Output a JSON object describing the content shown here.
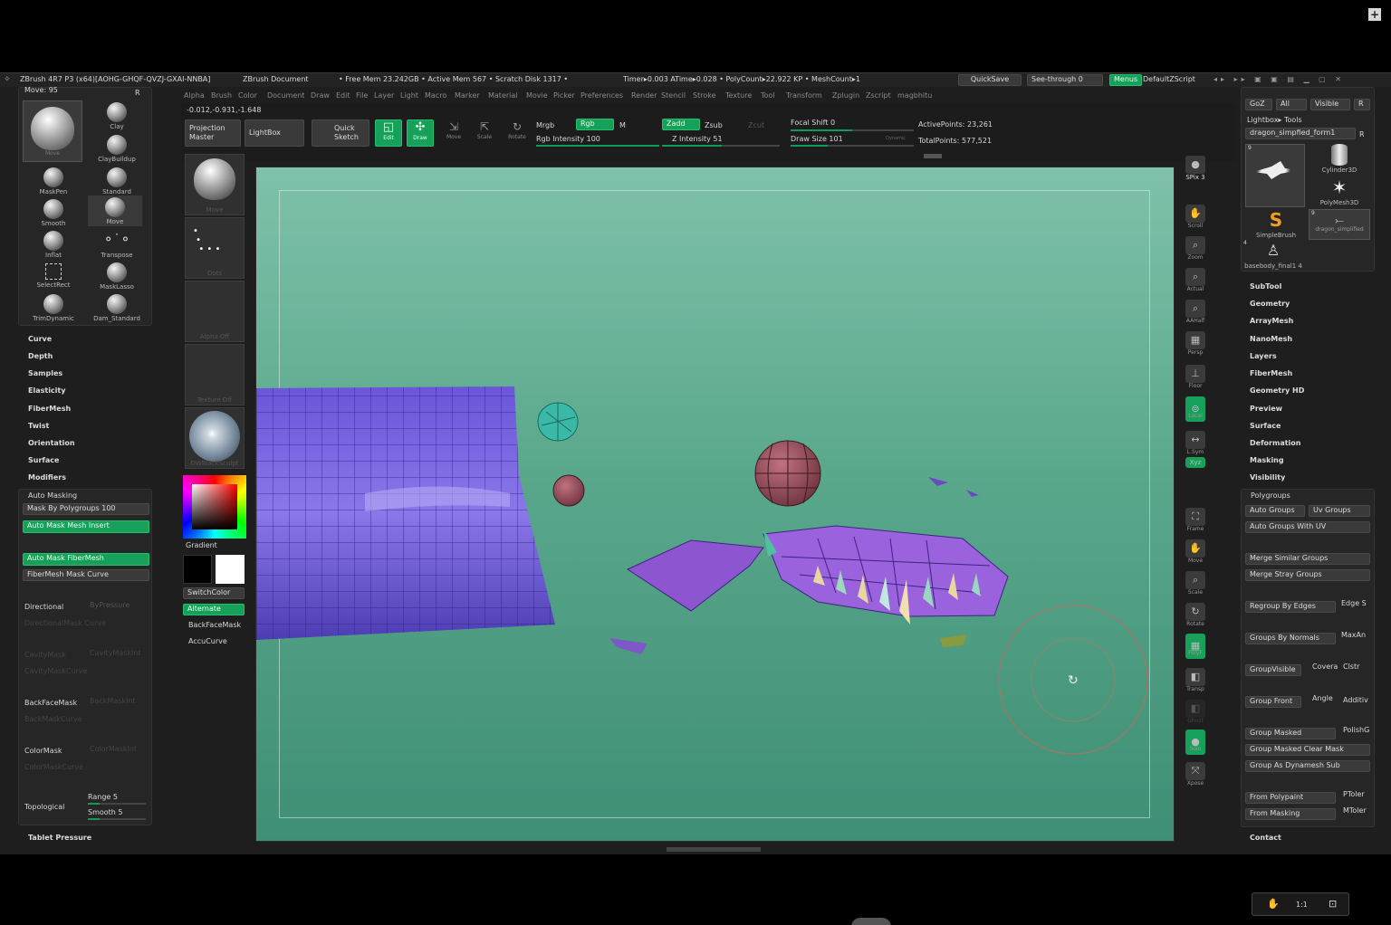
{
  "titlebar": {
    "app": "ZBrush 4R7 P3 (x64)[AOHG-GHQF-QVZJ-GXAI-NNBA]",
    "document": "ZBrush Document",
    "stats": "• Free Mem 23.242GB • Active Mem 567 • Scratch Disk 1317 •",
    "timer": "Timer▸0.003 ATime▸0.028 • PolyCount▸22.922 KP • MeshCount▸1",
    "quicksave": "QuickSave",
    "seethrough": "See-through 0",
    "menus": "Menus",
    "script": "DefaultZScript"
  },
  "menubar": [
    "Alpha",
    "Brush",
    "Color",
    "Document",
    "Draw",
    "Edit",
    "File",
    "Layer",
    "Light",
    "Macro",
    "Marker",
    "Material",
    "Movie",
    "Picker",
    "Preferences",
    "Render",
    "Stencil",
    "Stroke",
    "Texture",
    "Tool",
    "Transform",
    "Zplugin",
    "Zscript",
    "magbhitu"
  ],
  "coords": "-0.012,-0.931,-1.648",
  "toolbar": {
    "projection_master": "Projection Master",
    "lightbox": "LightBox",
    "quick_sketch": "Quick Sketch",
    "edit": "Edit",
    "draw": "Draw",
    "move": "Move",
    "scale": "Scale",
    "rotate": "Rotate",
    "mrgb": "Mrgb",
    "rgb": "Rgb",
    "m": "M",
    "rgb_intensity": "Rgb Intensity 100",
    "zadd": "Zadd",
    "zsub": "Zsub",
    "zcut": "Zcut",
    "z_intensity": "Z Intensity 51",
    "focal_shift": "Focal Shift 0",
    "draw_size": "Draw Size 101",
    "dynamic": "Dynamic",
    "active_points": "ActivePoints: 23,261",
    "total_points": "TotalPoints: 577,521"
  },
  "left_panel": {
    "header": "Move: 95",
    "r": "R",
    "main_brush": "Move",
    "brushes": [
      "Clay",
      "ClayBuildup",
      "MaskPen",
      "Standard",
      "Smooth",
      "Move",
      "Inflat",
      "Transpose",
      "SelectRect",
      "MaskLasso",
      "TrimDynamic",
      "Dam_Standard"
    ],
    "menu": [
      "Curve",
      "Depth",
      "Samples",
      "Elasticity",
      "FiberMesh",
      "Twist",
      "Orientation",
      "Surface",
      "Modifiers"
    ],
    "auto_masking": {
      "title": "Auto Masking",
      "mask_by_polygroups": "Mask By Polygroups 100",
      "auto_mask_mesh_insert": "Auto Mask Mesh Insert",
      "auto_mask_fibermesh": "Auto Mask FiberMesh",
      "fibermesh_mask_curve": "FiberMesh Mask Curve",
      "directional": "Directional",
      "by_pressure": "ByPressure",
      "directional_mask_curve": "DirectionalMask Curve",
      "cavity_mask": "CavityMask",
      "cavity_mask_int": "CavityMaskInt",
      "cavity_mask_curve": "CavityMaskCurve",
      "backface_mask": "BackFaceMask",
      "backmask_int": "BackMaskInt",
      "backmask_curve": "BackMaskCurve",
      "color_mask": "ColorMask",
      "color_mask_int": "ColorMaskInt",
      "color_mask_curve": "ColorMaskCurve",
      "topological": "Topological",
      "range": "Range 5",
      "smooth": "Smooth 5"
    },
    "tablet_pressure": "Tablet Pressure"
  },
  "left_col2": {
    "move": "Move",
    "dots": "Dots",
    "alpha_off": "Alpha Off",
    "texture_off": "Texture Off",
    "material": "DWBlackSculpt",
    "gradient": "Gradient",
    "switch_color": "SwitchColor",
    "alternate": "Alternate",
    "backface_mask": "BackFaceMask",
    "accu_curve": "AccuCurve"
  },
  "right_icons": [
    "SPix 3",
    "Scroll",
    "Zoom",
    "Actual",
    "AAHalf",
    "Persp",
    "Floor",
    "Local",
    "L.Sym",
    "Xyz",
    "Frame",
    "Move",
    "Scale",
    "Rotate",
    "PolyF",
    "Transp",
    "Ghost",
    "Solo",
    "Xpose"
  ],
  "right_panel": {
    "top_row": [
      "GoZ",
      "All",
      "Visible",
      "R"
    ],
    "lightbox_tools": "Lightbox▸ Tools",
    "current_tool": "dragon_simpfied_form1",
    "r": "R",
    "tools": [
      "Cylinder3D",
      "PolyMesh3D",
      "SimpleBrush",
      "dragon_simplified",
      "basebody_final1 4"
    ],
    "tool_counts": [
      "9",
      "9",
      "4"
    ],
    "menu": [
      "SubTool",
      "Geometry",
      "ArrayMesh",
      "NanoMesh",
      "Layers",
      "FiberMesh",
      "Geometry HD",
      "Preview",
      "Surface",
      "Deformation",
      "Masking",
      "Visibility"
    ],
    "polygroups": {
      "title": "Polygroups",
      "auto_groups": "Auto Groups",
      "uv_groups": "Uv Groups",
      "auto_groups_uv": "Auto Groups With UV",
      "merge_similar": "Merge Similar Groups",
      "merge_stray": "Merge Stray Groups",
      "regroup_edges": "Regroup By Edges",
      "edge": "Edge S",
      "groups_normals": "Groups By Normals",
      "maxang": "MaxAn",
      "group_visible": "GroupVisible",
      "coverage": "Covera",
      "clstr": "Clstr",
      "group_front": "Group Front",
      "angle": "Angle",
      "additive": "Additiv",
      "group_masked": "Group Masked",
      "polish": "PolishG",
      "group_masked_clear": "Group Masked Clear Mask",
      "group_as_dynamesh": "Group As Dynamesh Sub",
      "from_polypaint": "From Polypaint",
      "ptoler": "PToler",
      "from_masking": "From Masking",
      "mtoler": "MToler"
    },
    "contact": "Contact"
  },
  "video_controls": {
    "ratio": "1:1"
  },
  "colors": {
    "accent": "#16a05a",
    "panel": "#262626",
    "viewport_top": "#7fc1aa",
    "viewport_bottom": "#3f8f76",
    "mesh": "#6a56d8"
  }
}
